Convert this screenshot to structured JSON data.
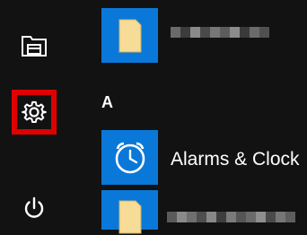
{
  "left_rail": {
    "items": [
      {
        "icon": "file-explorer-icon"
      },
      {
        "icon": "settings-icon",
        "highlighted": true,
        "highlight_color": "#e00000"
      },
      {
        "icon": "power-icon"
      }
    ]
  },
  "app_list": {
    "section_letter": "A",
    "apps": [
      {
        "name": "",
        "icon": "folder-icon",
        "label_obscured": true
      },
      {
        "name": "Alarms & Clock",
        "icon": "alarm-clock-icon"
      },
      {
        "name": "",
        "icon": "folder-icon",
        "label_obscured": true
      }
    ]
  },
  "colors": {
    "background": "#121212",
    "tile": "#0a78d8",
    "highlight": "#e00000"
  }
}
